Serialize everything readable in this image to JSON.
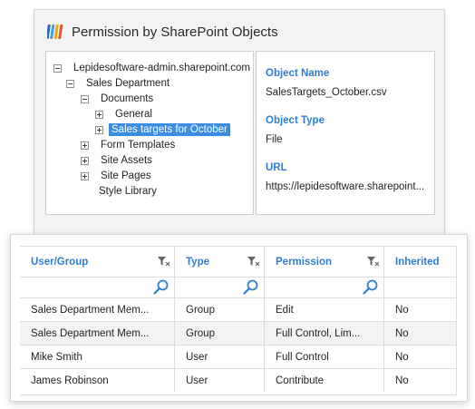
{
  "header": {
    "title": "Permission by SharePoint Objects",
    "logo_icon": "sharepoint-logo-icon"
  },
  "tree": {
    "nodes": [
      {
        "label": "Lepidesoftware-admin.sharepoint.com",
        "expander": "minus",
        "level": 0
      },
      {
        "label": "Sales Department",
        "expander": "minus",
        "level": 1
      },
      {
        "label": "Documents",
        "expander": "minus",
        "level": 2
      },
      {
        "label": "General",
        "expander": "plus",
        "level": 3
      },
      {
        "label": "Sales targets for October",
        "expander": "plus",
        "level": 3,
        "selected": true
      },
      {
        "label": "Form Templates",
        "expander": "plus",
        "level": 2
      },
      {
        "label": "Site Assets",
        "expander": "plus",
        "level": 2
      },
      {
        "label": "Site Pages",
        "expander": "plus",
        "level": 2
      },
      {
        "label": "Style Library",
        "expander": "none",
        "level": 2
      }
    ]
  },
  "details": {
    "object_name_label": "Object Name",
    "object_name_value": "SalesTargets_October.csv",
    "object_type_label": "Object Type",
    "object_type_value": "File",
    "url_label": "URL",
    "url_value": "https://lepidesoftware.sharepoint..."
  },
  "grid": {
    "columns": [
      "User/Group",
      "Type",
      "Permission",
      "Inherited"
    ],
    "rows": [
      [
        "Sales Department Mem...",
        "Group",
        "Edit",
        "No"
      ],
      [
        "Sales Department Mem...",
        "Group",
        "Full Control, Lim...",
        "No"
      ],
      [
        "Mike Smith",
        "User",
        "Full Control",
        "No"
      ],
      [
        "James Robinson",
        "User",
        "Contribute",
        "No"
      ]
    ]
  },
  "colors": {
    "accent": "#2b7fd3",
    "selection": "#3b8de0",
    "alt_row": "#f3f3f3"
  }
}
